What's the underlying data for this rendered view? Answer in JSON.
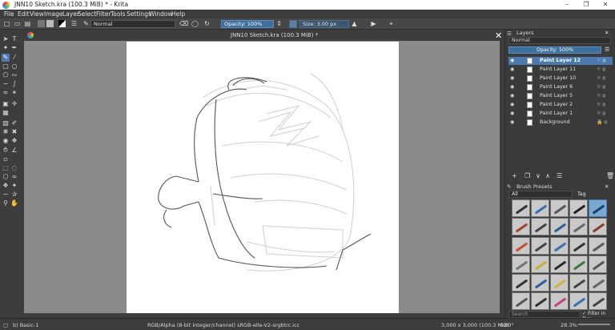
{
  "window": {
    "title": "JNN10 Sketch.kra (100.3 MiB) * - Krita",
    "minimize": "–",
    "maximize": "❐",
    "close": "✕"
  },
  "menu": [
    "File",
    "Edit",
    "View",
    "Image",
    "Layer",
    "Select",
    "Filter",
    "Tools",
    "Settings",
    "Window",
    "Help"
  ],
  "toolbar": {
    "blend_mode": "Normal",
    "opacity": "Opacity: 100%",
    "size": "Size: 3.00 px"
  },
  "document": {
    "tab_title": "JNN10 Sketch.kra (100.3 MiB) *",
    "close": "✕"
  },
  "layers_panel": {
    "title": "Layers",
    "blend_mode": "Normal",
    "opacity": "Opacity:  100%",
    "layers": [
      {
        "name": "Paint Layer 12",
        "selected": true
      },
      {
        "name": "Paint Layer 11",
        "selected": false
      },
      {
        "name": "Paint Layer 10",
        "selected": false
      },
      {
        "name": "Paint Layer 6",
        "selected": false
      },
      {
        "name": "Paint Layer 5",
        "selected": false
      },
      {
        "name": "Paint Layer 2",
        "selected": false
      },
      {
        "name": "Paint Layer 1",
        "selected": false
      },
      {
        "name": "Background",
        "selected": false
      }
    ]
  },
  "brush_presets": {
    "title": "Brush Presets",
    "filter": "All",
    "tag": "Tag",
    "search_placeholder": "Search",
    "filter_in_tag": "Filter in Tag"
  },
  "status": {
    "preset": "b) Basic-1",
    "color_space": "RGB/Alpha (8-bit integer/channel)  sRGB-elle-V2-srgbtrc.icc",
    "canvas_size": "3,000 x 3,000 (100.3 MiB)",
    "rotation": "0.00°",
    "zoom": "28.3%"
  },
  "colors": {
    "accent": "#4a7ab0",
    "panel": "#3a3a3a",
    "canvas_bg": "#8a8a8a"
  }
}
